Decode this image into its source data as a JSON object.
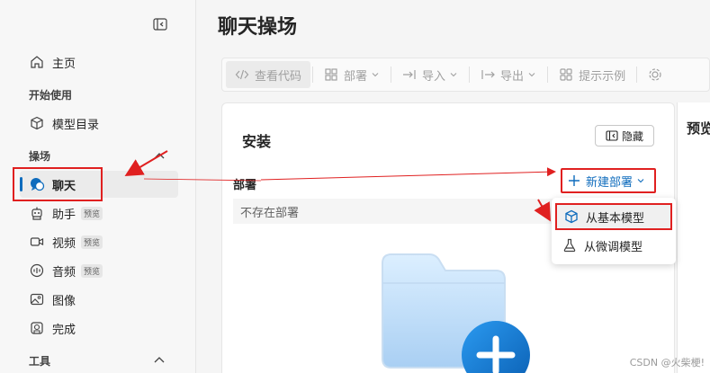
{
  "sidebar": {
    "sections": {
      "get_started": "开始使用",
      "playground": "操场",
      "tools": "工具"
    },
    "items": [
      {
        "label": "主页",
        "icon": "home-icon"
      },
      {
        "label": "模型目录",
        "icon": "cube-icon"
      },
      {
        "label": "聊天",
        "icon": "chat-icon",
        "active": true
      },
      {
        "label": "助手",
        "icon": "bot-icon",
        "badge": "预览"
      },
      {
        "label": "视频",
        "icon": "video-icon",
        "badge": "预览"
      },
      {
        "label": "音频",
        "icon": "audio-icon",
        "badge": "预览"
      },
      {
        "label": "图像",
        "icon": "image-icon"
      },
      {
        "label": "完成",
        "icon": "completion-icon"
      }
    ]
  },
  "main": {
    "title": "聊天操场",
    "toolbar": [
      {
        "label": "查看代码",
        "icon": "code-icon"
      },
      {
        "label": "部署",
        "icon": "deploy-icon",
        "has_dropdown": true
      },
      {
        "label": "导入",
        "icon": "import-icon",
        "has_dropdown": true
      },
      {
        "label": "导出",
        "icon": "export-icon",
        "has_dropdown": true
      },
      {
        "label": "提示示例",
        "icon": "grid-icon"
      }
    ],
    "setup_panel": {
      "title": "安装",
      "hide_label": "隐藏",
      "deployment_label": "部署",
      "new_deployment_label": "新建部署",
      "empty_row": "不存在部署"
    },
    "preview_title": "预览",
    "dropdown_menu": [
      {
        "label": "从基本模型",
        "icon": "cube-icon"
      },
      {
        "label": "从微调模型",
        "icon": "flask-icon"
      }
    ]
  },
  "watermark": "CSDN @火柴梗!",
  "colors": {
    "accent": "#0f6cbd",
    "annotation": "#e02020"
  }
}
